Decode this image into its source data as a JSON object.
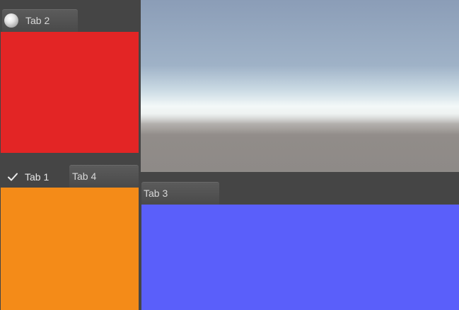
{
  "tabs": {
    "tab2": {
      "label": "Tab 2",
      "icon": "sphere-icon"
    },
    "tab1": {
      "label": "Tab 1",
      "icon": "checkmark-icon"
    },
    "tab4": {
      "label": "Tab 4"
    },
    "tab3": {
      "label": "Tab 3"
    }
  },
  "colors": {
    "background": "#454545",
    "tab2_panel": "#e32525",
    "tab1_panel": "#f48b18",
    "tab3_panel": "#5a5ffa"
  }
}
